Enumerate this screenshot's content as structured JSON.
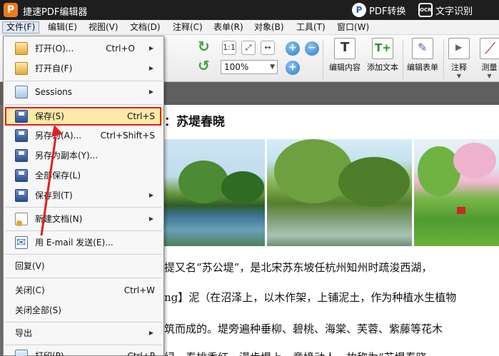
{
  "app": {
    "title": "捷速PDF编辑器",
    "logo_letter": "P",
    "pdf_convert": "PDF转换",
    "ocr_badge": "OCR",
    "ocr_label": "文字识别"
  },
  "menubar": {
    "items": [
      "文件(F)",
      "编辑(E)",
      "视图(V)",
      "文档(D)",
      "注释(C)",
      "表单(R)",
      "对象(B)",
      "工具(T)",
      "窗口(W)"
    ]
  },
  "toolbar": {
    "zoom_value": "100%",
    "edit_content": "编辑内容",
    "add_text": "添加文本",
    "edit_form": "编辑表单",
    "comment": "注释",
    "measure": "测量",
    "fit_page_label": "1:1"
  },
  "file_menu": {
    "items": [
      {
        "label": "打开(O)...",
        "shortcut": "Ctrl+O",
        "submenu": true,
        "icon": "folder-icon"
      },
      {
        "label": "打开自(F)",
        "shortcut": "",
        "submenu": true,
        "icon": "folder-open-icon"
      },
      {
        "label": "Sessions",
        "shortcut": "",
        "submenu": true,
        "icon": "sessions-icon"
      },
      {
        "label": "保存(S)",
        "shortcut": "Ctrl+S",
        "submenu": false,
        "icon": "save-icon"
      },
      {
        "label": "另存为(A)...",
        "shortcut": "Ctrl+Shift+S",
        "submenu": false,
        "icon": "save-as-icon"
      },
      {
        "label": "另存为副本(Y)...",
        "shortcut": "",
        "submenu": false,
        "icon": "save-copy-icon"
      },
      {
        "label": "全部保存(L)",
        "shortcut": "",
        "submenu": false,
        "icon": "save-all-icon"
      },
      {
        "label": "保存到(T)",
        "shortcut": "",
        "submenu": true,
        "icon": "save-to-icon"
      },
      {
        "label": "新建文档(N)",
        "shortcut": "",
        "submenu": true,
        "icon": "new-document-icon"
      },
      {
        "label": "用 E-mail 发送(E)...",
        "shortcut": "",
        "submenu": false,
        "icon": "email-icon"
      },
      {
        "label": "回复(V)",
        "shortcut": "",
        "submenu": false,
        "icon": ""
      },
      {
        "label": "关闭(C)",
        "shortcut": "Ctrl+W",
        "submenu": false,
        "icon": ""
      },
      {
        "label": "关闭全部(S)",
        "shortcut": "",
        "submenu": false,
        "icon": ""
      },
      {
        "label": "导出",
        "shortcut": "",
        "submenu": true,
        "icon": ""
      },
      {
        "label": "打印(P)...",
        "shortcut": "Ctrl+P",
        "submenu": false,
        "icon": "print-icon"
      }
    ]
  },
  "document": {
    "heading": "：苏堤春晓",
    "lines": [
      "提又名“苏公堤”，是北宋苏东坡任杭州知州时疏浚西湖，",
      "ng】泥（在沼泽上，以木作架，上铺泥土，作为种植水生植物",
      "筑而成的。堤旁遍种垂柳、碧桃、海棠、芙蓉、紫藤等花木",
      "绿，春桃香红，漫步堤上，意境动人，故称为“苏堤春晓"
    ]
  },
  "colors": {
    "titlebar": "#1e1e1e",
    "highlight": "#fde9a8",
    "annotation_red": "#e02020"
  }
}
